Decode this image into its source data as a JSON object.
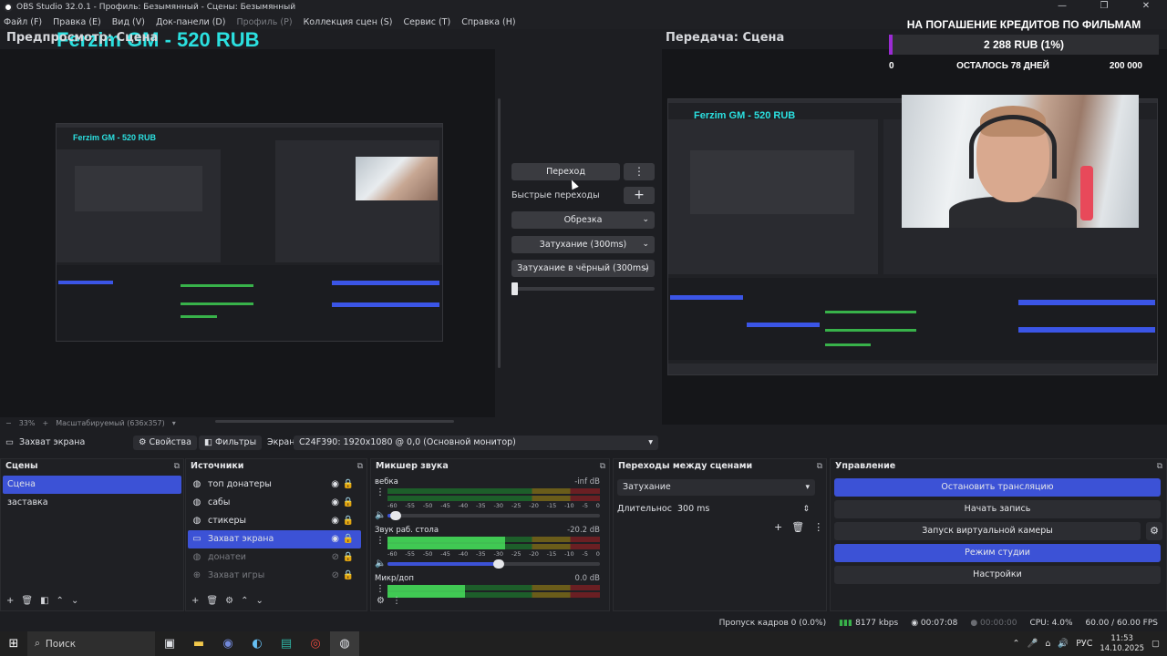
{
  "window": {
    "title": "OBS Studio 32.0.1 - Профиль: Безымянный - Сцены: Безымянный",
    "controls": [
      "—",
      "❐",
      "✕"
    ]
  },
  "menu": [
    "Файл (F)",
    "Правка (E)",
    "Вид (V)",
    "Док-панели (D)",
    "Профиль (P)",
    "Коллекция сцен (S)",
    "Сервис (T)",
    "Справка (H)"
  ],
  "preview": {
    "label": "Предпросмотр: Сцена",
    "donation_text": "Ferzim GM - 520 RUB",
    "zoom": "33%",
    "scale_mode": "Масштабируемый (636x357)"
  },
  "program": {
    "label": "Передача: Сцена"
  },
  "credit_widget": {
    "title": "НА ПОГАШЕНИЕ КРЕДИТОВ ПО ФИЛЬМАМ",
    "current": "2 288 RUB (1%)",
    "min": "0",
    "remaining": "ОСТАЛОСЬ 78 ДНЕЙ",
    "max": "200 000",
    "progress_percent": 1,
    "fill_color": "#9b2bd4"
  },
  "transition_panel": {
    "transition_button": "Переход",
    "quick_transitions_label": "Быстрые переходы",
    "quick": [
      "Обрезка",
      "Затухание (300ms)",
      "Затухание в чёрный (300ms)"
    ]
  },
  "source_bar": {
    "source_name": "Захват экрана",
    "properties": "Свойства",
    "filters": "Фильтры",
    "screen_label": "Экран",
    "screen_value": "C24F390: 1920x1080 @ 0,0 (Основной монитор)"
  },
  "scenes": {
    "title": "Сцены",
    "items": [
      "Сцена",
      "заставка"
    ]
  },
  "sources": {
    "title": "Источники",
    "items": [
      {
        "name": "топ донатеры",
        "icon": "globe-icon",
        "visible": true
      },
      {
        "name": "сабы",
        "icon": "globe-icon",
        "visible": true
      },
      {
        "name": "стикеры",
        "icon": "globe-icon",
        "visible": true
      },
      {
        "name": "Захват экрана",
        "icon": "monitor-icon",
        "visible": true
      },
      {
        "name": "донатеи",
        "icon": "globe-icon",
        "visible": false
      },
      {
        "name": "Захват игры",
        "icon": "gamepad-icon",
        "visible": false
      }
    ]
  },
  "mixer": {
    "title": "Микшер звука",
    "scale": [
      "-60",
      "-55",
      "-50",
      "-45",
      "-40",
      "-35",
      "-30",
      "-25",
      "-20",
      "-15",
      "-10",
      "-5",
      "0"
    ],
    "channels": [
      {
        "name": "вебка",
        "db": "-inf dB",
        "level": 0.0,
        "volume": 0.04
      },
      {
        "name": "Звук раб. стола",
        "db": "-20.2 dB",
        "level": 0.55,
        "volume": 0.52
      },
      {
        "name": "Микр/доп",
        "db": "0.0 dB",
        "level": 0.36,
        "volume": 0.36
      }
    ]
  },
  "scene_transitions": {
    "title": "Переходы между сценами",
    "selected": "Затухание",
    "duration_label": "Длительность",
    "duration_value": "300 ms"
  },
  "controls": {
    "title": "Управление",
    "stop_stream": "Остановить трансляцию",
    "start_record": "Начать запись",
    "virtual_cam": "Запуск виртуальной камеры",
    "studio_mode": "Режим студии",
    "settings": "Настройки"
  },
  "status": {
    "dropped": "Пропуск кадров 0 (0.0%)",
    "bitrate": "8177 kbps",
    "stream_time": "00:07:08",
    "record_time": "00:00:00",
    "cpu": "CPU: 4.0%",
    "fps": "60.00 / 60.00 FPS"
  },
  "taskbar": {
    "search": "Поиск",
    "lang": "РУС",
    "time": "11:53",
    "date": "14.10.2025"
  },
  "colors": {
    "accent": "#3c52d6",
    "donation_text": "#2be0e0",
    "meter_green": "#38b24a"
  }
}
